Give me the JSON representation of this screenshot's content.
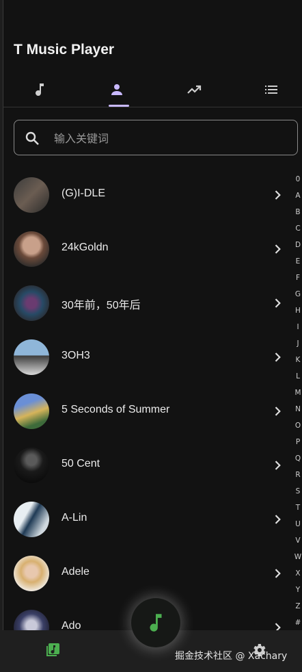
{
  "app": {
    "title": "T Music Player"
  },
  "tabs": [
    {
      "icon": "music-note-icon",
      "active": false
    },
    {
      "icon": "person-icon",
      "active": true
    },
    {
      "icon": "trending-up-icon",
      "active": false
    },
    {
      "icon": "list-icon",
      "active": false
    }
  ],
  "search": {
    "placeholder": "输入关键词"
  },
  "artists": [
    {
      "name": "(G)I-DLE"
    },
    {
      "name": "24kGoldn"
    },
    {
      "name": "30年前，50年后"
    },
    {
      "name": "3OH3"
    },
    {
      "name": "5 Seconds of Summer"
    },
    {
      "name": "50 Cent"
    },
    {
      "name": "A-Lin"
    },
    {
      "name": "Adele"
    },
    {
      "name": "Ado"
    }
  ],
  "alphabet": [
    "0",
    "A",
    "B",
    "C",
    "D",
    "E",
    "F",
    "G",
    "H",
    "I",
    "J",
    "K",
    "L",
    "M",
    "N",
    "O",
    "P",
    "Q",
    "R",
    "S",
    "T",
    "U",
    "V",
    "W",
    "X",
    "Y",
    "Z",
    "#"
  ],
  "colors": {
    "accent": "#c9b9ff",
    "green": "#4caf50",
    "background": "#121212"
  },
  "watermark": "掘金技术社区 @ Xachary"
}
